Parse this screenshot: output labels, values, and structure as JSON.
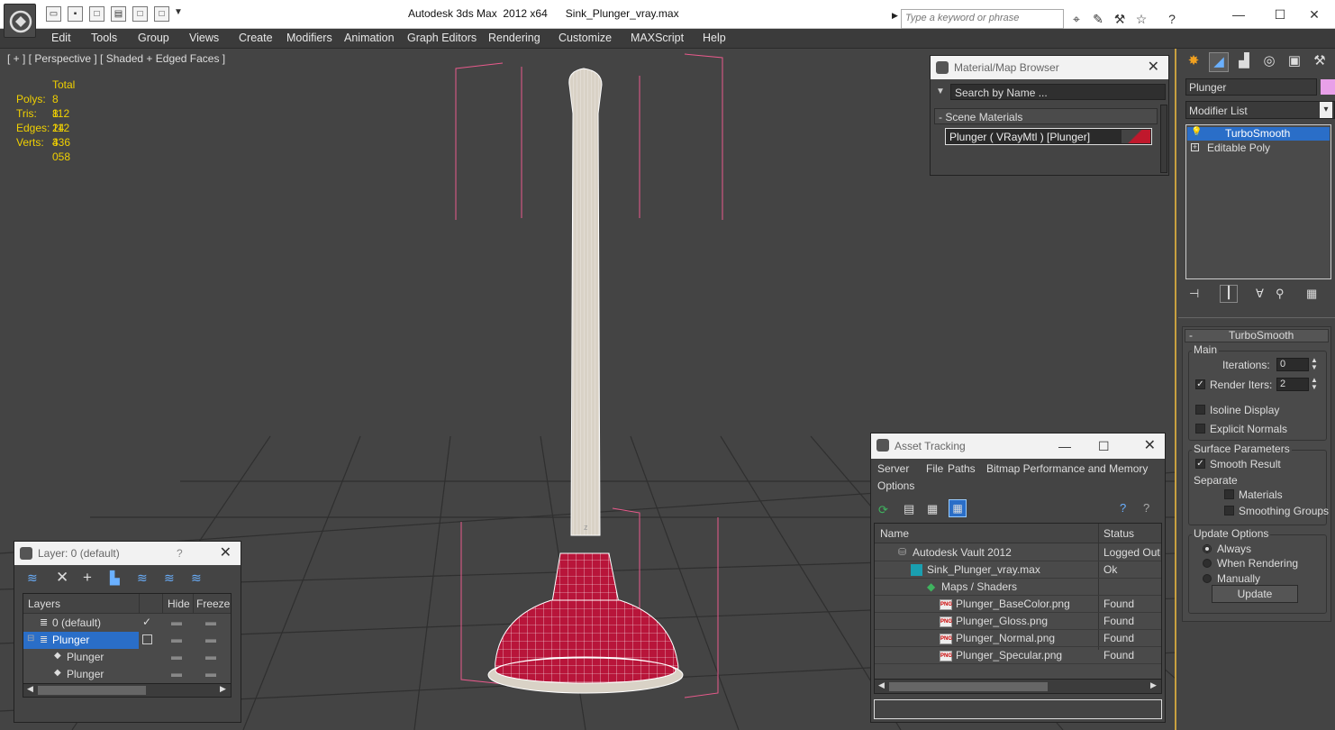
{
  "titlebar": {
    "title": "Autodesk 3ds Max  2012 x64      Sink_Plunger_vray.max",
    "search_placeholder": "Type a keyword or phrase"
  },
  "menu": [
    "Edit",
    "Tools",
    "Group",
    "Views",
    "Create",
    "Modifiers",
    "Animation",
    "Graph Editors",
    "Rendering",
    "Customize",
    "MAXScript",
    "Help"
  ],
  "viewport": {
    "label": "[ + ] [ Perspective ] [ Shaded + Edged Faces ]",
    "stats_header": "Total",
    "stats": [
      {
        "key": "Polys:",
        "value": "8 112"
      },
      {
        "key": "Tris:",
        "value": "8 112"
      },
      {
        "key": "Edges:",
        "value": "24 336"
      },
      {
        "key": "Verts:",
        "value": "4 058"
      }
    ],
    "axis_label": "z"
  },
  "material_browser": {
    "title": "Material/Map Browser",
    "search_placeholder": "Search by Name ...",
    "section": "- Scene Materials",
    "item": "Plunger  ( VRayMtl )  [Plunger]"
  },
  "layer_panel": {
    "title": "Layer: 0 (default)",
    "help": "?",
    "columns": [
      "Layers",
      "Hide",
      "Freeze"
    ],
    "rows": [
      "0 (default)",
      "Plunger",
      "Plunger",
      "Plunger"
    ]
  },
  "asset_tracking": {
    "title": "Asset Tracking",
    "menu": [
      "Server",
      "File",
      "Paths",
      "Bitmap Performance and Memory",
      "Options"
    ],
    "columns": [
      "Name",
      "Status"
    ],
    "rows": [
      {
        "name": "Autodesk Vault 2012",
        "status": "Logged Out"
      },
      {
        "name": "Sink_Plunger_vray.max",
        "status": "Ok"
      },
      {
        "name": "Maps / Shaders",
        "status": ""
      },
      {
        "name": "Plunger_BaseColor.png",
        "status": "Found"
      },
      {
        "name": "Plunger_Gloss.png",
        "status": "Found"
      },
      {
        "name": "Plunger_Normal.png",
        "status": "Found"
      },
      {
        "name": "Plunger_Specular.png",
        "status": "Found"
      }
    ],
    "png_badge": "PNG"
  },
  "command_panel": {
    "object_name": "Plunger",
    "object_color": "#e8a0e8",
    "modifier_list": "Modifier List",
    "stack": [
      "TurboSmooth",
      "Editable Poly"
    ],
    "rollout_title": "TurboSmooth",
    "main_group": "Main",
    "iterations_label": "Iterations:",
    "iterations_value": "0",
    "render_iters_label": "Render Iters:",
    "render_iters_value": "2",
    "render_iters_checked": true,
    "isoline_label": "Isoline Display",
    "explicit_normals_label": "Explicit Normals",
    "surface_group": "Surface Parameters",
    "smooth_result_label": "Smooth Result",
    "separate_label": "Separate",
    "materials_label": "Materials",
    "smoothing_groups_label": "Smoothing Groups",
    "update_group": "Update Options",
    "always_label": "Always",
    "when_rendering_label": "When Rendering",
    "manually_label": "Manually",
    "update_button": "Update"
  }
}
